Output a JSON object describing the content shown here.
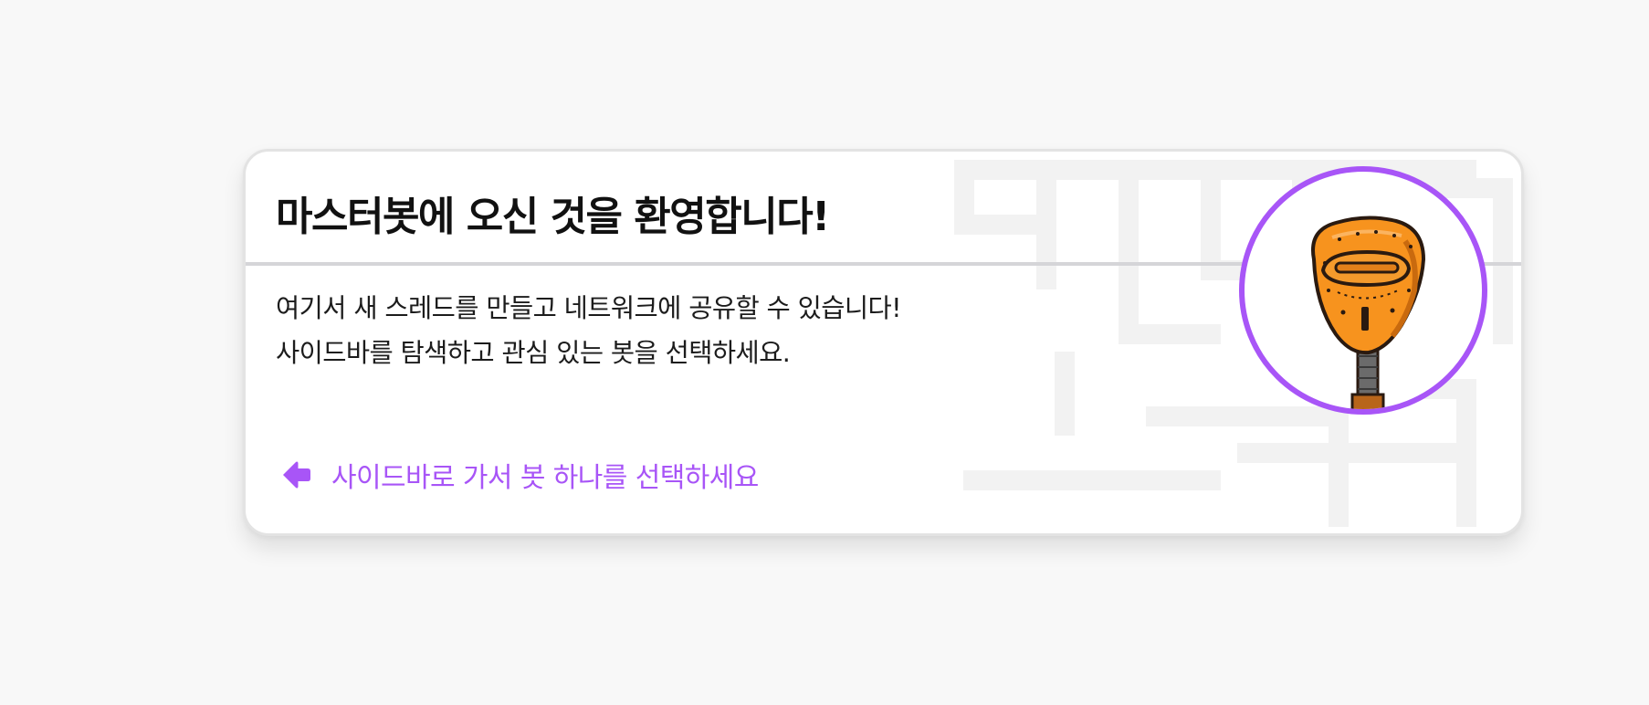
{
  "welcome_card": {
    "title": "마스터봇에 오신 것을 환영합니다!",
    "description": "여기서 새 스레드를 만들고 네트워크에 공유할 수 있습니다! 사이드바를 탐색하고 관심 있는 봇을 선택하세요.",
    "cta": {
      "label": "사이드바로 가서 봇 하나를 선택하세요",
      "icon": "arrow-left-icon"
    },
    "avatar": {
      "icon": "robot-head-icon"
    }
  },
  "colors": {
    "accent": "#a855f7",
    "page_background": "#f8f8f8",
    "card_background": "#ffffff",
    "card_border": "#e3e3e3",
    "divider": "#d5d5d8",
    "title_text": "#111111",
    "body_text": "#1c1c1c",
    "robot_orange": "#f7931e",
    "robot_outline": "#2a1a10",
    "robot_neck": "#6b6b6b"
  }
}
